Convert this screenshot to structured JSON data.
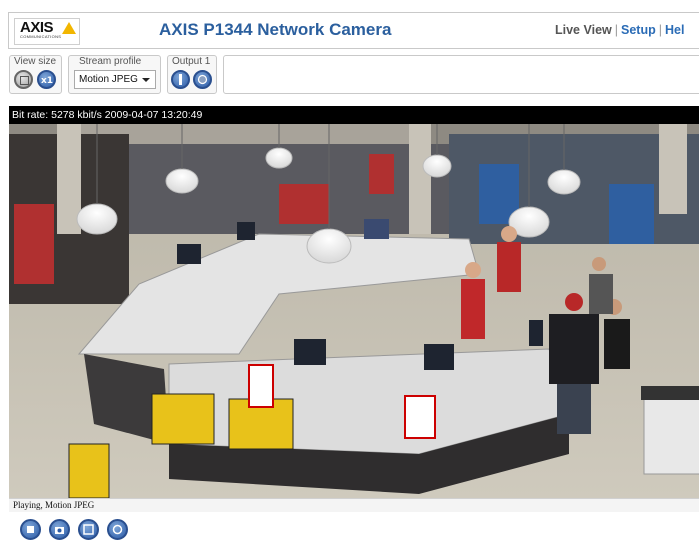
{
  "header": {
    "logo_text": "AXIS",
    "logo_subtext": "COMMUNICATIONS",
    "camera_title": "AXIS P1344 Network Camera",
    "nav": {
      "live_view": "Live View",
      "separator": "|",
      "setup": "Setup",
      "help": "Hel"
    }
  },
  "toolbar": {
    "view_size": {
      "label": "View size",
      "buttons": [
        "view-size-full-icon",
        "view-size-scaled-icon"
      ]
    },
    "stream_profile": {
      "label": "Stream profile",
      "selected": "Motion JPEG"
    },
    "output": {
      "label": "Output 1",
      "buttons": [
        "output-on-icon",
        "output-pulse-icon"
      ]
    }
  },
  "video": {
    "bitrate_text": "Bit rate:  5278 kbit/s 2009-04-07 13:20:49"
  },
  "status": {
    "text": "Playing, Motion JPEG"
  },
  "controls": [
    "stop-icon",
    "snapshot-icon",
    "fullscreen-icon",
    "play-icon"
  ],
  "colors": {
    "title_blue": "#2b5f9e",
    "link_blue": "#2b6cb6",
    "button_blue": "#2a5aa6",
    "logo_yellow": "#f2b600"
  }
}
